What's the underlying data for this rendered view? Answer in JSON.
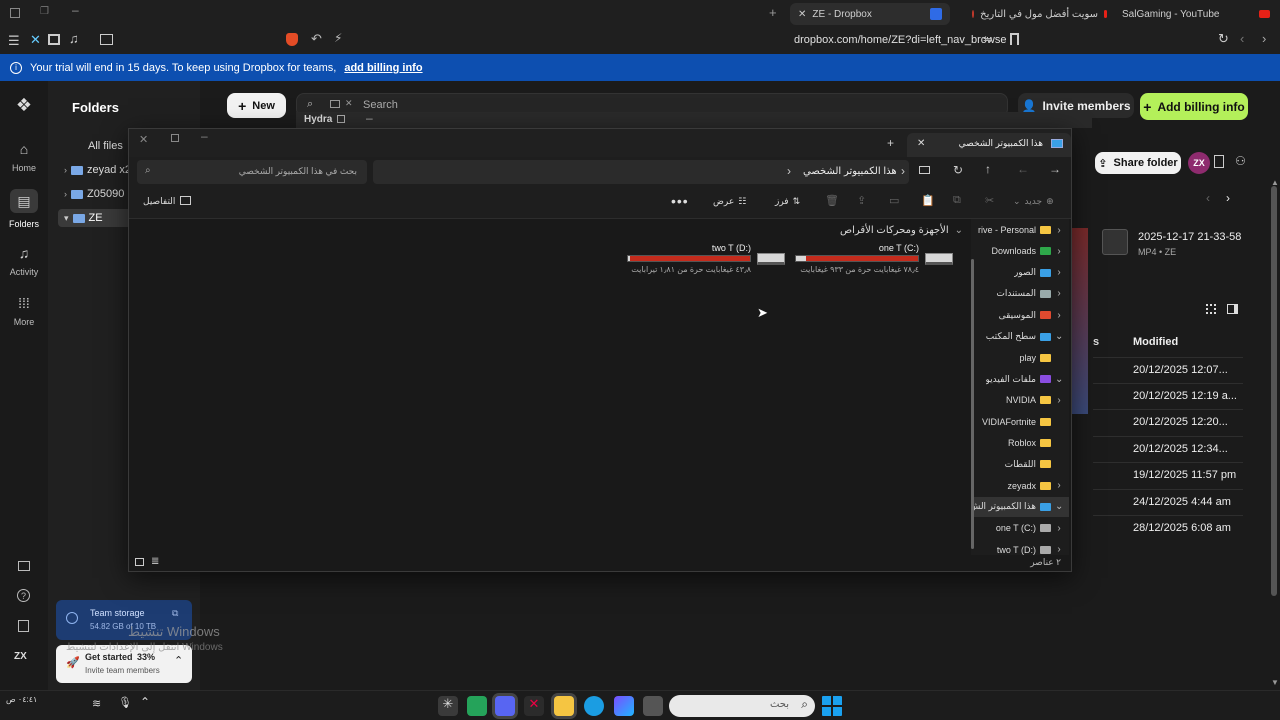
{
  "browser": {
    "tabs": [
      {
        "label": "ZE - Dropbox"
      },
      {
        "label": "سويت أفضل مول في التاريخ"
      },
      {
        "label": "SalGaming - YouTube"
      }
    ],
    "url": "dropbox.com/home/ZE?di=left_nav_browse"
  },
  "banner": {
    "text": "Your trial will end in 15 days. To keep using Dropbox for teams,",
    "link": "add billing info"
  },
  "rail": {
    "items": [
      {
        "label": "Home"
      },
      {
        "label": "Folders"
      },
      {
        "label": "Activity"
      },
      {
        "label": "More"
      }
    ],
    "avatar": "ZX"
  },
  "folders_panel": {
    "title": "Folders",
    "all_files": "All files",
    "items": [
      {
        "label": "zeyad x2"
      },
      {
        "label": "Z05090"
      },
      {
        "label": "ZE"
      }
    ],
    "storage_title": "Team storage",
    "storage_text": "54.82 GB of 10 TB",
    "get_started": "Get started",
    "get_started_pct": "33%",
    "get_started_sub": "Invite team members"
  },
  "main": {
    "new_label": "New",
    "search_placeholder": "Search",
    "invite_label": "Invite members",
    "billing_label": "Add billing info",
    "share_label": "Share folder",
    "avatar": "ZX",
    "hydra_label": "Hydra",
    "file_name": "2025-12-17 21-33-58",
    "file_meta": "MP4 • ZE",
    "col_partial": "s",
    "modified_header": "Modified",
    "dates": [
      "20/12/2025 12:07...",
      "20/12/2025 12:19 a...",
      "20/12/2025 12:20...",
      "20/12/2025 12:34...",
      "19/12/2025 11:57 pm",
      "24/12/2025 4:44 am",
      "28/12/2025 6:08 am"
    ]
  },
  "explorer": {
    "title": "هذا الكمبيوتر الشخصي",
    "address": "هذا الكمبيوتر الشخصي",
    "search_placeholder": "بحث في هذا الكمبيوتر الشخصي",
    "cmd_new": "جديد",
    "cmd_sort": "فرز",
    "cmd_view": "عرض",
    "cmd_details": "التفاصيل",
    "section_title": "الأجهزة ومحركات الأقراص",
    "drives": [
      {
        "name": "one T  (C:)",
        "free_text": "٧٨٫٤ غيغابايت حرة من ٩٣٣ غيغابايت",
        "used_fraction": 0.92
      },
      {
        "name": "two T (D:)",
        "free_text": "٤٣٫٨ غيغابايت حرة من ١٫٨١ تيرابايت",
        "used_fraction": 0.98
      }
    ],
    "nav": [
      {
        "label": "rive - Personal"
      },
      {
        "label": "Downloads"
      },
      {
        "label": "الصور"
      },
      {
        "label": "المستندات"
      },
      {
        "label": "الموسيقى"
      },
      {
        "label": "سطح المكتب"
      },
      {
        "label": "play"
      },
      {
        "label": "ملفات الفيديو"
      },
      {
        "label": "NVIDIA"
      },
      {
        "label": "VIDIAFortnite"
      },
      {
        "label": "Roblox"
      },
      {
        "label": "اللقطات"
      },
      {
        "label": "zeyadx"
      },
      {
        "label": "هذا الكمبيوتر الش"
      },
      {
        "label": "one T  (C:)"
      },
      {
        "label": "two T (D:)"
      }
    ],
    "status": "٢ عناصر"
  },
  "watermark": {
    "line1": "تنشيط Windows",
    "line2": "انتقل إلى الإعدادات لتنشيط Windows"
  },
  "taskbar": {
    "search_placeholder": "بحث",
    "clock": "٠٤:٤١ ص"
  }
}
